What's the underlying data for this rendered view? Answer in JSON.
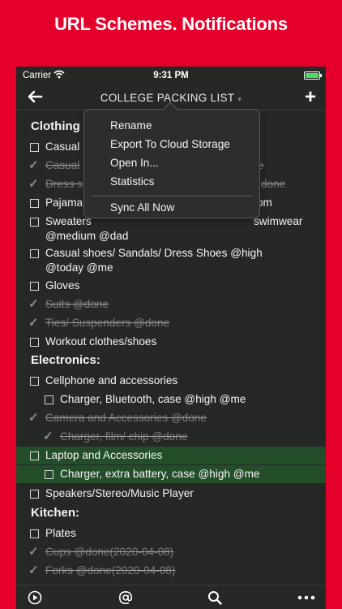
{
  "banner": {
    "title": "URL Schemes. Notifications"
  },
  "status_bar": {
    "carrier": "Carrier",
    "time": "9:31 PM"
  },
  "nav": {
    "title": "COLLEGE PACKING LIST",
    "caret": "▾",
    "add": "+"
  },
  "menu": {
    "items": [
      "Rename",
      "Export To Cloud Storage",
      "Open In...",
      "Statistics"
    ],
    "footer_item": "Sync All Now"
  },
  "list": {
    "headings": [
      "Clothing",
      "Electronics:",
      "Kitchen:"
    ],
    "items": [
      {
        "text": "Casual",
        "done": false
      },
      {
        "text": "Casual",
        "tail": "e",
        "done": true
      },
      {
        "text": "Dress s",
        "tail": "done",
        "done": true
      },
      {
        "text": "Pajama",
        "tail": "om",
        "done": false
      },
      {
        "text": "Sweaters",
        "tail": "swimwear",
        "line2": "@medium @dad",
        "done": false
      },
      {
        "text": "Casual shoes/ Sandals/ Dress Shoes @high",
        "line2": "@today @me",
        "done": false
      },
      {
        "text": "Gloves",
        "done": false
      },
      {
        "text": "Suits @done",
        "done": true
      },
      {
        "text": "Ties/ Suspenders @done",
        "done": true
      },
      {
        "text": "Workout clothes/shoes",
        "done": false
      },
      {
        "text": "Cellphone and accessories",
        "done": false
      },
      {
        "text": "Charger, Bluetooth, case @high @me",
        "done": false
      },
      {
        "text": "Camera and Accessories @done",
        "done": true
      },
      {
        "text": "Charger, film/ chip @done",
        "done": true
      },
      {
        "text": "Laptop and Accessories",
        "done": false,
        "highlight": true
      },
      {
        "text": "Charger, extra battery, case @high @me",
        "done": false,
        "highlight": true
      },
      {
        "text": "Speakers/Stereo/Music Player",
        "done": false
      },
      {
        "text": "Plates",
        "done": false
      },
      {
        "text": "Cups @done(2020-04-08)",
        "done": true
      },
      {
        "text": "Forks @done(2020-04-08)",
        "done": true
      }
    ]
  },
  "icons": {
    "back": "back-arrow-icon",
    "add": "plus-icon",
    "play": "play-icon",
    "at": "at-sign-icon",
    "search": "search-icon",
    "more": "more-icon"
  },
  "colors": {
    "brand_red": "#e4002b",
    "background": "#262826",
    "highlight": "#244e2a",
    "battery": "#4bd964"
  }
}
